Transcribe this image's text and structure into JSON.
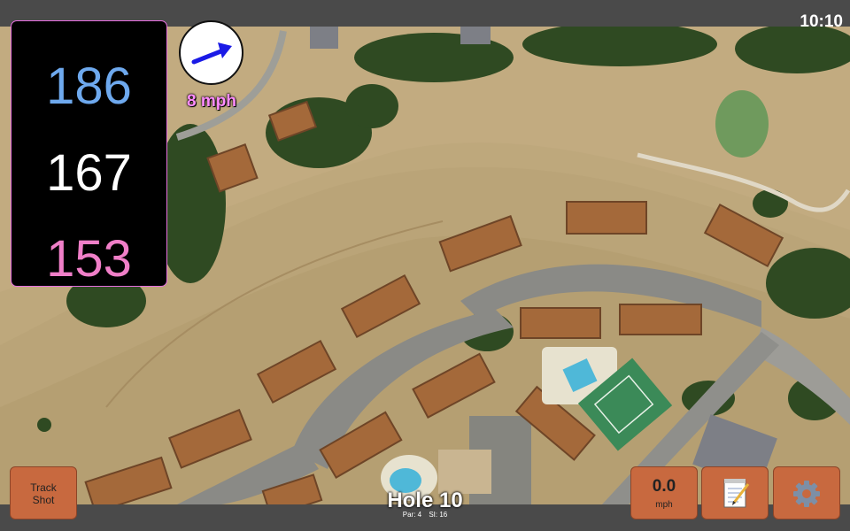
{
  "status_bar": {
    "time": "10:10"
  },
  "distances": {
    "back": "186",
    "middle": "167",
    "front": "153"
  },
  "wind": {
    "speed_label": "8 mph"
  },
  "hole": {
    "title": "Hole 10",
    "par": "Par: 4",
    "stroke_index": "SI: 16"
  },
  "buttons": {
    "track_shot_line1": "Track",
    "track_shot_line2": "Shot",
    "wind_value": "0.0",
    "wind_unit": "mph",
    "scorecard_icon": "notepad-icon",
    "settings_icon": "gear-icon"
  },
  "colors": {
    "back_distance": "#6ea9ee",
    "middle_distance": "#ffffff",
    "front_distance": "#f07fc8",
    "wind_label": "#ff8cff",
    "wind_arrow": "#1a1ae6",
    "button_bg": "#c8693f",
    "panel_border": "#e76fe0"
  }
}
